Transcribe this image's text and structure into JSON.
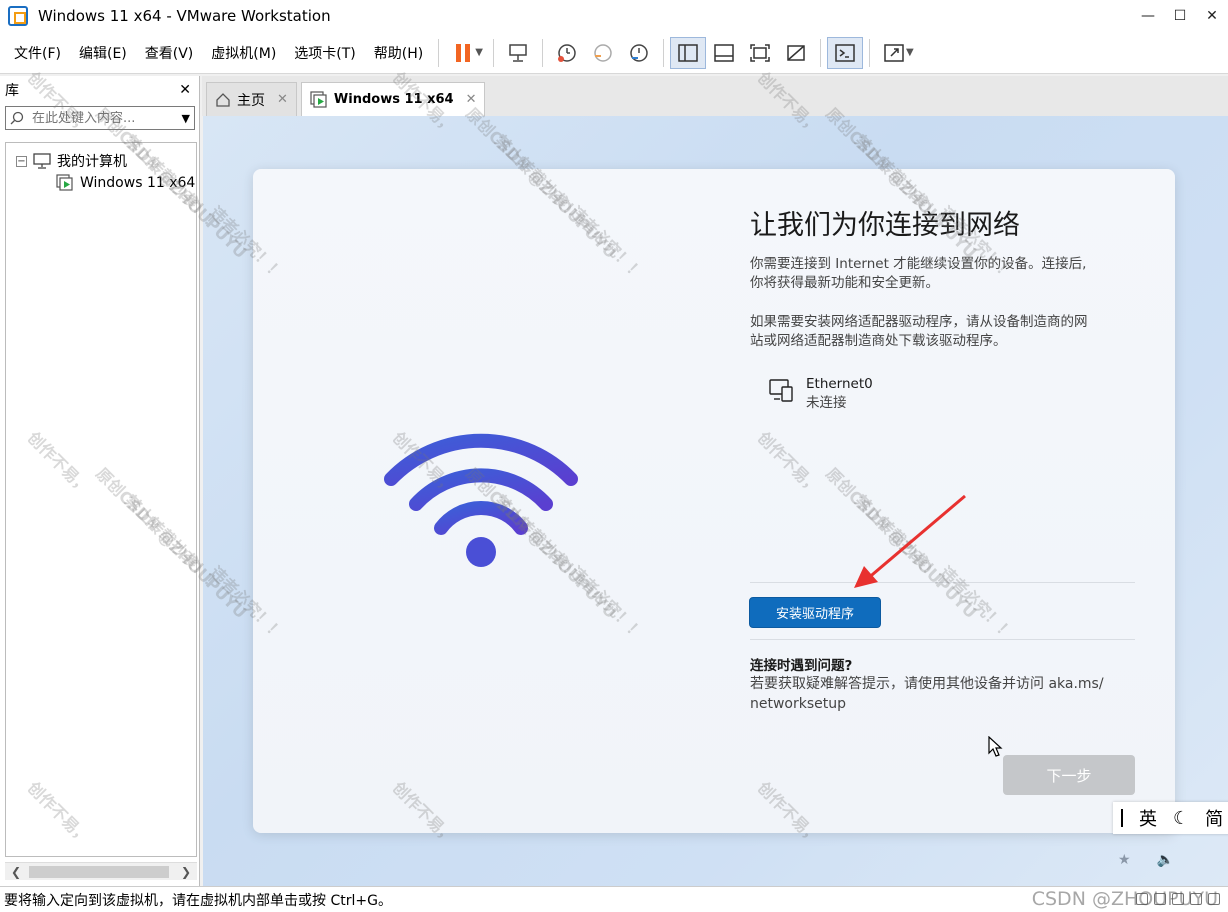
{
  "window": {
    "title": "Windows 11 x64 - VMware Workstation"
  },
  "menu": [
    "文件(F)",
    "编辑(E)",
    "查看(V)",
    "虚拟机(M)",
    "选项卡(T)",
    "帮助(H)"
  ],
  "library": {
    "title": "库",
    "search_placeholder": "在此处键入内容...",
    "tree": {
      "root": "我的计算机",
      "child": "Windows 11 x64"
    }
  },
  "tabs": [
    {
      "label": "主页"
    },
    {
      "label": "Windows 11 x64"
    }
  ],
  "oobe": {
    "title": "让我们为你连接到网络",
    "desc1_line1": "你需要连接到 Internet 才能继续设置你的设备。连接后,",
    "desc1_line2": "你将获得最新功能和安全更新。",
    "desc2_line1": "如果需要安装网络适配器驱动程序，请从设备制造商的网",
    "desc2_line2": "站或网络适配器制造商处下载该驱动程序。",
    "network_name": "Ethernet0",
    "network_status": "未连接",
    "install_button": "安装驱动程序",
    "help_title": "连接时遇到问题?",
    "help_line1": "若要获取疑难解答提示，请使用其他设备并访问 aka.ms/",
    "help_line2": "networksetup",
    "next_button": "下一步",
    "ime": {
      "lang": "英",
      "mode": "简"
    }
  },
  "statusbar": {
    "text": "要将输入定向到该虚拟机，请在虚拟机内部单击或按 Ctrl+G。"
  },
  "watermark": {
    "a": "创作不易，",
    "b": "原创CSDN @ZHOUPUYU",
    "c": "禁止转载抄袭！！",
    "d": "违者必究！！",
    "csdn": "CSDN @ZHOUPUYU"
  },
  "colors": {
    "primary_button": "#0f6cbd",
    "pause_icon": "#f26522",
    "annotation_arrow": "#e8312f"
  }
}
